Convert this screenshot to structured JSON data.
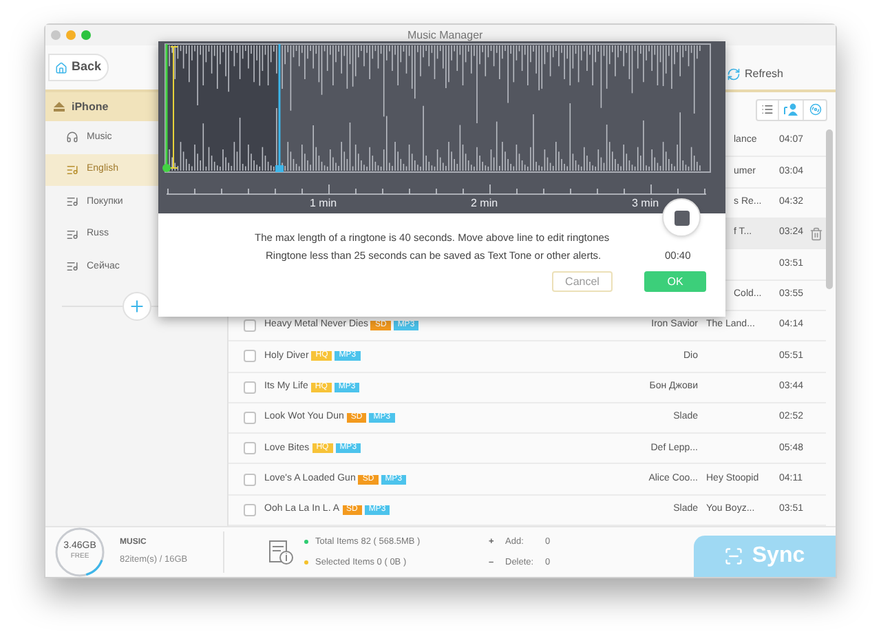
{
  "window": {
    "title": "Music Manager"
  },
  "toolbar": {
    "back": "Back",
    "refresh": "Refresh"
  },
  "sidebar": {
    "device": "iPhone",
    "items": [
      {
        "label": "Music",
        "kind": "library",
        "selected": false
      },
      {
        "label": "English",
        "kind": "playlist",
        "selected": true
      },
      {
        "label": "Покупки",
        "kind": "playlist",
        "selected": false
      },
      {
        "label": "Russ",
        "kind": "playlist",
        "selected": false
      },
      {
        "label": "Сейчас",
        "kind": "playlist",
        "selected": false
      }
    ]
  },
  "rows": [
    {
      "kind": "partial",
      "album": "lance",
      "time": "04:07",
      "hovered": false
    },
    {
      "kind": "partial",
      "album": "umer",
      "time": "03:04",
      "hovered": false
    },
    {
      "kind": "partial",
      "album": "s Re...",
      "time": "04:32",
      "hovered": false
    },
    {
      "kind": "partial",
      "album": "f T...",
      "time": "03:24",
      "hovered": true
    },
    {
      "kind": "partial",
      "time": "03:51",
      "hovered": false
    },
    {
      "kind": "partial",
      "album": "Cold...",
      "time": "03:55",
      "hovered": false
    },
    {
      "kind": "full",
      "checked": false,
      "title": "Heavy Metal Never Dies",
      "badges": [
        {
          "label": "SD",
          "color": "#f39a1e"
        },
        {
          "label": "MP3",
          "color": "#4cc3ec"
        }
      ],
      "artist": "Iron Savior",
      "album": "The Land...",
      "time": "04:14",
      "hovered": false
    },
    {
      "kind": "full",
      "checked": false,
      "title": "Holy Diver",
      "badges": [
        {
          "label": "HQ",
          "color": "#f7c338"
        },
        {
          "label": "MP3",
          "color": "#4cc3ec"
        }
      ],
      "artist": "Dio",
      "time": "05:51",
      "hovered": false
    },
    {
      "kind": "full",
      "checked": false,
      "title": "Its My Life",
      "badges": [
        {
          "label": "HQ",
          "color": "#f7c338"
        },
        {
          "label": "MP3",
          "color": "#4cc3ec"
        }
      ],
      "artist": "Бон Джови",
      "time": "03:44",
      "hovered": false
    },
    {
      "kind": "full",
      "checked": false,
      "title": "Look Wot You Dun",
      "badges": [
        {
          "label": "SD",
          "color": "#f39a1e"
        },
        {
          "label": "MP3",
          "color": "#4cc3ec"
        }
      ],
      "artist": "Slade",
      "time": "02:52",
      "hovered": false
    },
    {
      "kind": "full",
      "checked": false,
      "title": "Love Bites",
      "badges": [
        {
          "label": "HQ",
          "color": "#f7c338"
        },
        {
          "label": "MP3",
          "color": "#4cc3ec"
        }
      ],
      "artist": "Def Lepp...",
      "time": "05:48",
      "hovered": false
    },
    {
      "kind": "full",
      "checked": false,
      "title": "Love's A Loaded Gun",
      "badges": [
        {
          "label": "SD",
          "color": "#f39a1e"
        },
        {
          "label": "MP3",
          "color": "#4cc3ec"
        }
      ],
      "artist": "Alice Coo...",
      "album": "Hey Stoopid",
      "time": "04:11",
      "hovered": false
    },
    {
      "kind": "full",
      "checked": false,
      "title": "Ooh La La In L. A",
      "badges": [
        {
          "label": "SD",
          "color": "#f39a1e"
        },
        {
          "label": "MP3",
          "color": "#4cc3ec"
        }
      ],
      "artist": "Slade",
      "album": "You Boyz...",
      "time": "03:51",
      "hovered": false
    }
  ],
  "dialog": {
    "timeline_labels": [
      "1 min",
      "2 min",
      "3 min"
    ],
    "message": "The max length of a ringtone is 40 seconds. Move above line to edit ringtones",
    "note": "Ringtone less than 25 seconds can be saved as Text Tone or other alerts.",
    "duration": "00:40",
    "cancel": "Cancel",
    "ok": "OK"
  },
  "status_bar": {
    "storage": {
      "free": "3.46GB",
      "free_label": "FREE",
      "level": 0.15
    },
    "category": "MUSIC",
    "usage": "82item(s) / 16GB",
    "stats": [
      {
        "label": "Total Items 82 ( 568.5MB )",
        "color": "#2ecc71"
      },
      {
        "label": "Selected Items 0 ( 0B )",
        "color": "#f5c22b"
      }
    ],
    "changes": [
      {
        "sign": "+",
        "label": "Add:",
        "value": "0"
      },
      {
        "sign": "–",
        "label": "Delete:",
        "value": "0"
      }
    ],
    "sync": "Sync"
  }
}
